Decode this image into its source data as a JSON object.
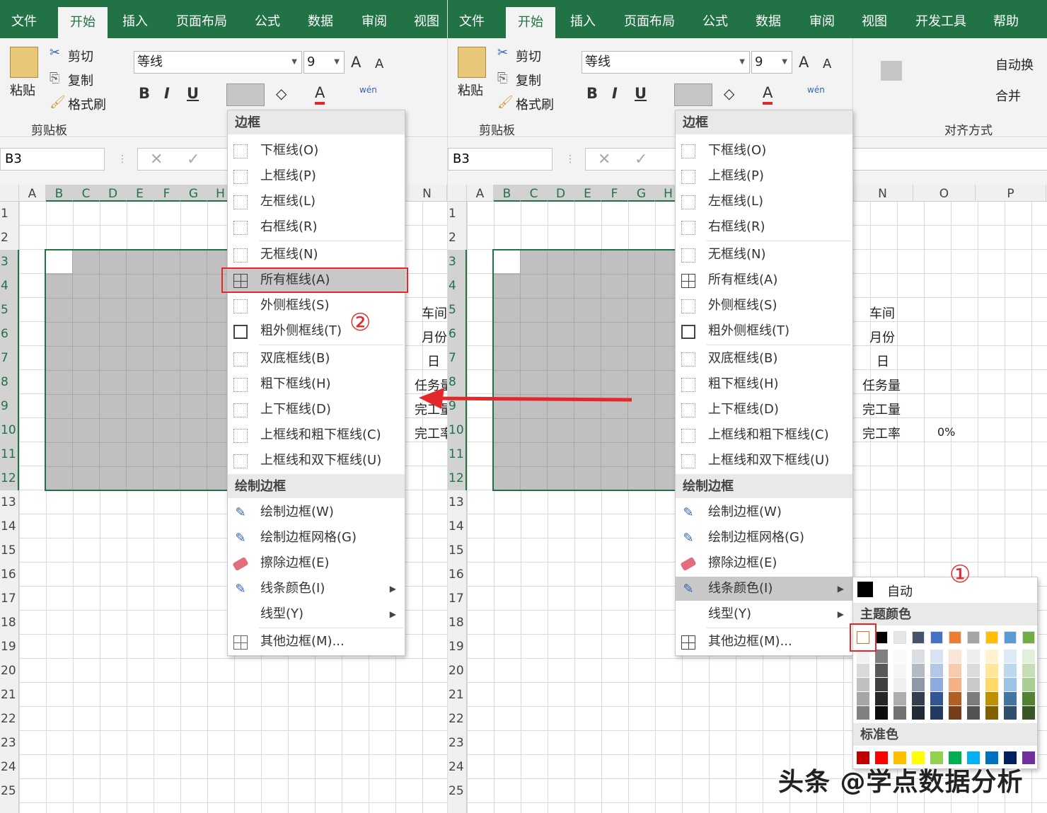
{
  "tabs": [
    "文件",
    "开始",
    "插入",
    "页面布局",
    "公式",
    "数据",
    "审阅",
    "视图",
    "开发工具",
    "帮助"
  ],
  "active_tab": "开始",
  "clipboard": {
    "paste": "粘贴",
    "cut": "剪切",
    "copy": "复制",
    "format_painter": "格式刷",
    "group": "剪贴板"
  },
  "font": {
    "name": "等线",
    "size": "9",
    "bold": "B",
    "italic": "I",
    "underline": "U",
    "grow": "A",
    "shrink": "A",
    "pinyin": "wén"
  },
  "alignment": {
    "wrap": "自动换",
    "merge": "合并",
    "group": "对齐方式"
  },
  "namebox": "B3",
  "columns_left": [
    "A",
    "B",
    "C",
    "D",
    "E",
    "F",
    "G",
    "H"
  ],
  "columns_right": [
    "N",
    "O",
    "P"
  ],
  "rows": [
    "1",
    "2",
    "3",
    "4",
    "5",
    "6",
    "7",
    "8",
    "9",
    "10",
    "11",
    "12",
    "13",
    "14",
    "15",
    "16",
    "17",
    "18",
    "19",
    "20",
    "21",
    "22",
    "23",
    "24",
    "25"
  ],
  "cells_right": [
    {
      "row": "5",
      "n": "车间",
      "o": ""
    },
    {
      "row": "6",
      "n": "月份",
      "o": ""
    },
    {
      "row": "7",
      "n": "日",
      "o": ""
    },
    {
      "row": "8",
      "n": "任务量",
      "o": ""
    },
    {
      "row": "9",
      "n": "完工量",
      "o": ""
    },
    {
      "row": "10",
      "n": "完工率",
      "o": "0%"
    }
  ],
  "cells_left": [
    "车间",
    "月份",
    "日",
    "任务量",
    "完工量",
    "完工率"
  ],
  "menu": {
    "header_border": "边框",
    "items": [
      "下框线(O)",
      "上框线(P)",
      "左框线(L)",
      "右框线(R)",
      "无框线(N)",
      "所有框线(A)",
      "外侧框线(S)",
      "粗外侧框线(T)",
      "双底框线(B)",
      "粗下框线(H)",
      "上下框线(D)",
      "上框线和粗下框线(C)",
      "上框线和双下框线(U)"
    ],
    "header_draw": "绘制边框",
    "draw_items": [
      "绘制边框(W)",
      "绘制边框网格(G)",
      "擦除边框(E)",
      "线条颜色(I)",
      "线型(Y)",
      "其他边框(M)..."
    ]
  },
  "palette": {
    "auto": "自动",
    "theme": "主题颜色",
    "standard": "标准色",
    "theme_colors": [
      "#ffffff",
      "#000000",
      "#e7e6e6",
      "#44546a",
      "#4472c4",
      "#ed7d31",
      "#a5a5a5",
      "#ffc000",
      "#5b9bd5",
      "#70ad47"
    ],
    "standard_colors": [
      "#c00000",
      "#ff0000",
      "#ffc000",
      "#ffff00",
      "#92d050",
      "#00b050",
      "#00b0f0",
      "#0070c0",
      "#002060",
      "#7030a0"
    ]
  },
  "annotations": {
    "step1": "①",
    "step2": "②"
  },
  "watermark": "头条 @学点数据分析",
  "colors": {
    "excel_green": "#217346",
    "highlight_red": "#e2282b"
  }
}
